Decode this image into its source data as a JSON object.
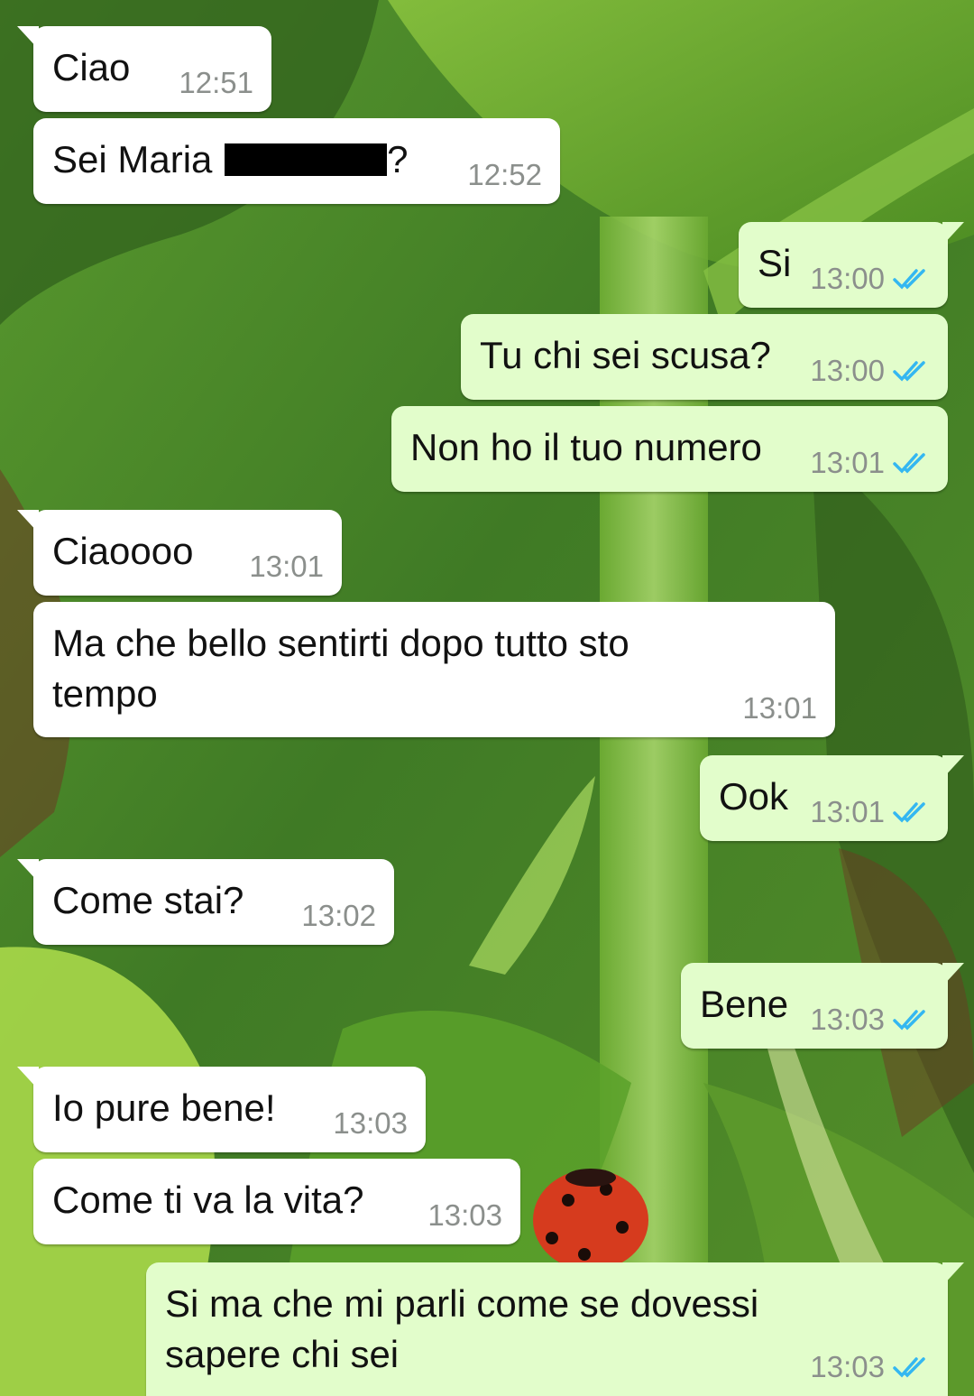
{
  "theme": {
    "incoming_bubble": "#ffffff",
    "outgoing_bubble": "#e2fdcb",
    "timestamp_color": "#8b8f8c",
    "read_tick_color": "#34b7f1"
  },
  "wallpaper": {
    "description_icon": "leaf-ladybug-wallpaper"
  },
  "messages": [
    {
      "dir": "in",
      "text": "Ciao",
      "time": "12:51"
    },
    {
      "dir": "in",
      "text_before": "Sei Maria ",
      "text_after": "?",
      "redacted": true,
      "time": "12:52"
    },
    {
      "dir": "out",
      "text": "Si",
      "time": "13:00",
      "status": "read"
    },
    {
      "dir": "out",
      "text": "Tu chi sei scusa?",
      "time": "13:00",
      "status": "read"
    },
    {
      "dir": "out",
      "text": "Non ho il tuo numero",
      "time": "13:01",
      "status": "read"
    },
    {
      "dir": "in",
      "text": "Ciaoooo",
      "time": "13:01"
    },
    {
      "dir": "in",
      "text": "Ma che bello sentirti dopo tutto sto tempo",
      "time": "13:01"
    },
    {
      "dir": "out",
      "text": "Ook",
      "time": "13:01",
      "status": "read"
    },
    {
      "dir": "in",
      "text": "Come stai?",
      "time": "13:02"
    },
    {
      "dir": "out",
      "text": "Bene",
      "time": "13:03",
      "status": "read"
    },
    {
      "dir": "in",
      "text": "Io pure bene!",
      "time": "13:03"
    },
    {
      "dir": "in",
      "text": "Come ti va la vita?",
      "time": "13:03"
    },
    {
      "dir": "out",
      "text": "Si ma che mi parli come se dovessi sapere chi sei",
      "time": "13:03",
      "status": "read"
    }
  ]
}
